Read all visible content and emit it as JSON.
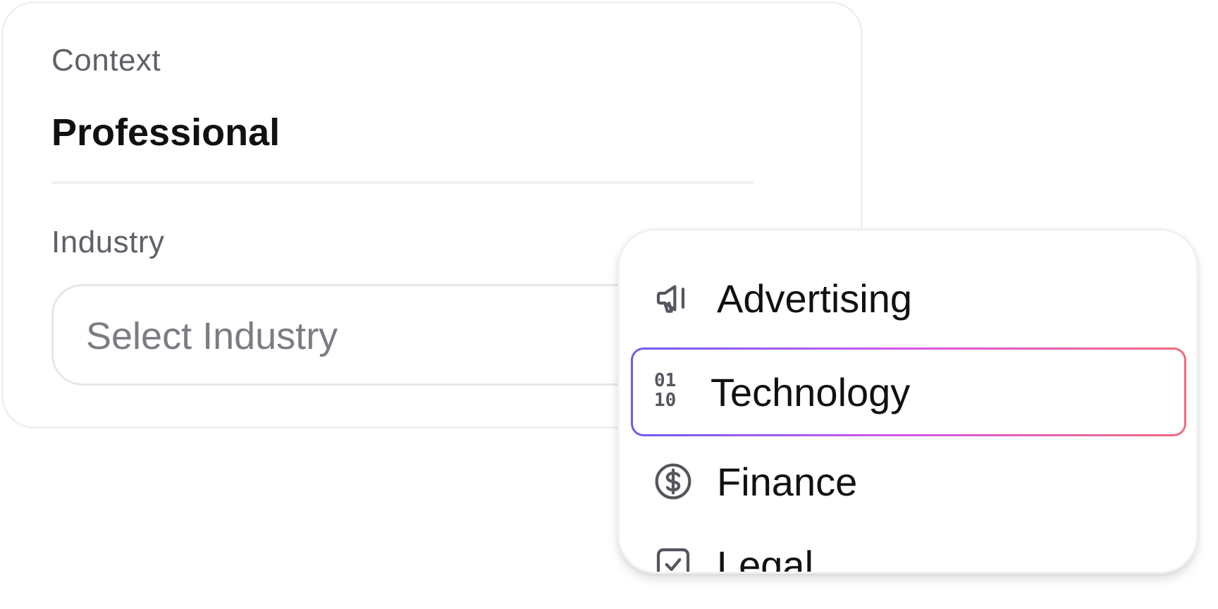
{
  "form": {
    "context_label": "Context",
    "context_value": "Professional",
    "industry_label": "Industry",
    "industry_placeholder": "Select Industry"
  },
  "dropdown": {
    "options": [
      {
        "label": "Advertising",
        "icon": "megaphone-icon",
        "selected": false
      },
      {
        "label": "Technology",
        "icon": "binary-icon",
        "selected": true
      },
      {
        "label": "Finance",
        "icon": "dollar-circle-icon",
        "selected": false
      },
      {
        "label": "Legal",
        "icon": "check-square-icon",
        "selected": false
      }
    ]
  },
  "colors": {
    "selected_gradient_start": "#6b5cf0",
    "selected_gradient_mid": "#d756e8",
    "selected_gradient_end": "#f06a7a",
    "label_gray": "#5f6068",
    "placeholder_gray": "#7b7c84"
  },
  "icons": {
    "binary_top": "01",
    "binary_bottom": "10"
  }
}
